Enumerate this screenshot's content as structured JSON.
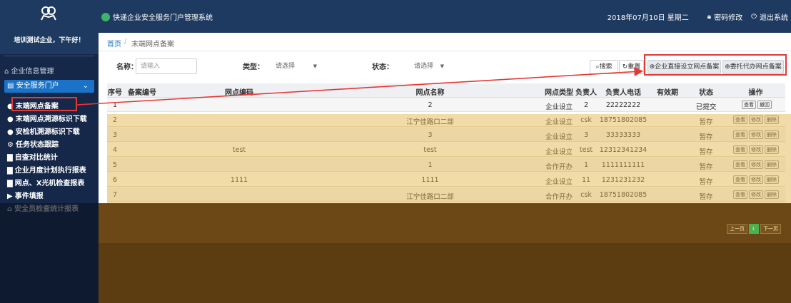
{
  "header": {
    "app_title": "快递企业安全服务门户管理系统",
    "date": "2018年07月10日 星期二",
    "change_password": "密码修改",
    "logout": "退出系统"
  },
  "sidebar": {
    "greeting": "培训测试企业，下午好！",
    "section_label": "企业信息管理",
    "active_menu": "安全服务门户",
    "items": [
      {
        "label": "末端网点备案"
      },
      {
        "label": "末端网点溯源标识下载"
      },
      {
        "label": "安检机溯源标识下载"
      },
      {
        "label": "任务状态跟踪"
      },
      {
        "label": "自查对比统计"
      },
      {
        "label": "企业月度计划执行报表"
      },
      {
        "label": "网点、X光机检查报表"
      },
      {
        "label": "事件填报"
      },
      {
        "label": "安全员检查统计报表"
      }
    ]
  },
  "breadcrumb": {
    "home": "首页",
    "sep": "/",
    "current": "末端网点备案"
  },
  "filters": {
    "name_label": "名称：",
    "name_placeholder": "请输入",
    "type_label": "类型：",
    "type_value": "请选择",
    "status_label": "状态：",
    "status_value": "请选择"
  },
  "buttons": {
    "search": "搜索",
    "reset": "重置",
    "add_direct": "企业直接设立网点备案",
    "add_delegate": "委托代办网点备案"
  },
  "table": {
    "columns": [
      "序号",
      "备案编号",
      "网点编码",
      "网点名称",
      "网点类型",
      "负责人",
      "负责人电话",
      "有效期",
      "状态",
      "操作"
    ],
    "rows": [
      {
        "no": "1",
        "record": "",
        "code": "",
        "name": "2",
        "type": "企业设立",
        "person": "2",
        "phone": "22222222",
        "valid": "",
        "status": "已提交",
        "ops": [
          "查看",
          "撤回"
        ]
      },
      {
        "no": "2",
        "record": "",
        "code": "",
        "name": "江宁佳路口二部",
        "type": "企业设立",
        "person": "csk",
        "phone": "18751802085",
        "valid": "",
        "status": "暂存",
        "ops": [
          "查看",
          "修改",
          "删除"
        ]
      },
      {
        "no": "3",
        "record": "",
        "code": "",
        "name": "3",
        "type": "企业设立",
        "person": "3",
        "phone": "33333333",
        "valid": "",
        "status": "暂存",
        "ops": [
          "查看",
          "修改",
          "删除"
        ]
      },
      {
        "no": "4",
        "record": "",
        "code": "test",
        "name": "test",
        "type": "企业设立",
        "person": "test",
        "phone": "12312341234",
        "valid": "",
        "status": "暂存",
        "ops": [
          "查看",
          "修改",
          "删除"
        ]
      },
      {
        "no": "5",
        "record": "",
        "code": "",
        "name": "1",
        "type": "合作开办",
        "person": "1",
        "phone": "1111111111",
        "valid": "",
        "status": "暂存",
        "ops": [
          "查看",
          "修改",
          "删除"
        ]
      },
      {
        "no": "6",
        "record": "",
        "code": "1111",
        "name": "1111",
        "type": "企业设立",
        "person": "11",
        "phone": "1231231232",
        "valid": "",
        "status": "暂存",
        "ops": [
          "查看",
          "修改",
          "删除"
        ]
      },
      {
        "no": "7",
        "record": "",
        "code": "",
        "name": "江宁佳路口二部",
        "type": "合作开办",
        "person": "csk",
        "phone": "18751802085",
        "valid": "",
        "status": "暂存",
        "ops": [
          "查看",
          "修改",
          "删除"
        ]
      }
    ]
  },
  "pagination": {
    "prev": "上一页",
    "current": "1",
    "next": "下一页"
  },
  "colors": {
    "header_bg": "#1e3a60",
    "sidebar_bg": "#16284a",
    "active_blue": "#1a73c8",
    "annotation_red": "#e53935"
  }
}
